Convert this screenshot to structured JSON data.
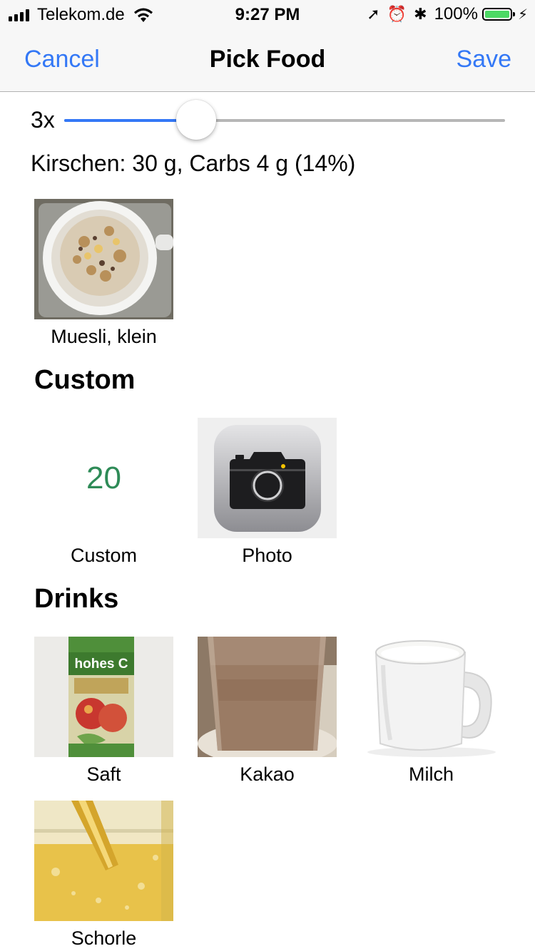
{
  "status_bar": {
    "carrier": "Telekom.de",
    "time": "9:27 PM",
    "battery_percent": "100%",
    "icons": [
      "signal-icon",
      "wifi-icon",
      "location-icon",
      "alarm-icon",
      "bluetooth-icon",
      "battery-icon",
      "charging-icon"
    ],
    "battery_level": 1.0
  },
  "nav": {
    "cancel_label": "Cancel",
    "title": "Pick Food",
    "save_label": "Save"
  },
  "slider": {
    "multiplier_label": "3x",
    "value_fraction": 0.3,
    "accent_color": "#3478f6"
  },
  "summary_text": "Kirschen: 30 g, Carbs 4 g (14%)",
  "recent_items": [
    {
      "label": "Muesli, klein",
      "image": "muesli-photo"
    }
  ],
  "sections": {
    "custom": {
      "title": "Custom",
      "items": [
        {
          "label": "Custom",
          "value": "20",
          "color": "#2e8b57"
        },
        {
          "label": "Photo",
          "image": "camera-app-icon"
        }
      ]
    },
    "drinks": {
      "title": "Drinks",
      "items": [
        {
          "label": "Saft",
          "image": "juice-carton-photo",
          "packaging_text": "hohes C"
        },
        {
          "label": "Kakao",
          "image": "cocoa-glass-photo"
        },
        {
          "label": "Milch",
          "image": "milk-mug-photo"
        },
        {
          "label": "Schorle",
          "image": "spritzer-glass-photo"
        }
      ]
    }
  }
}
